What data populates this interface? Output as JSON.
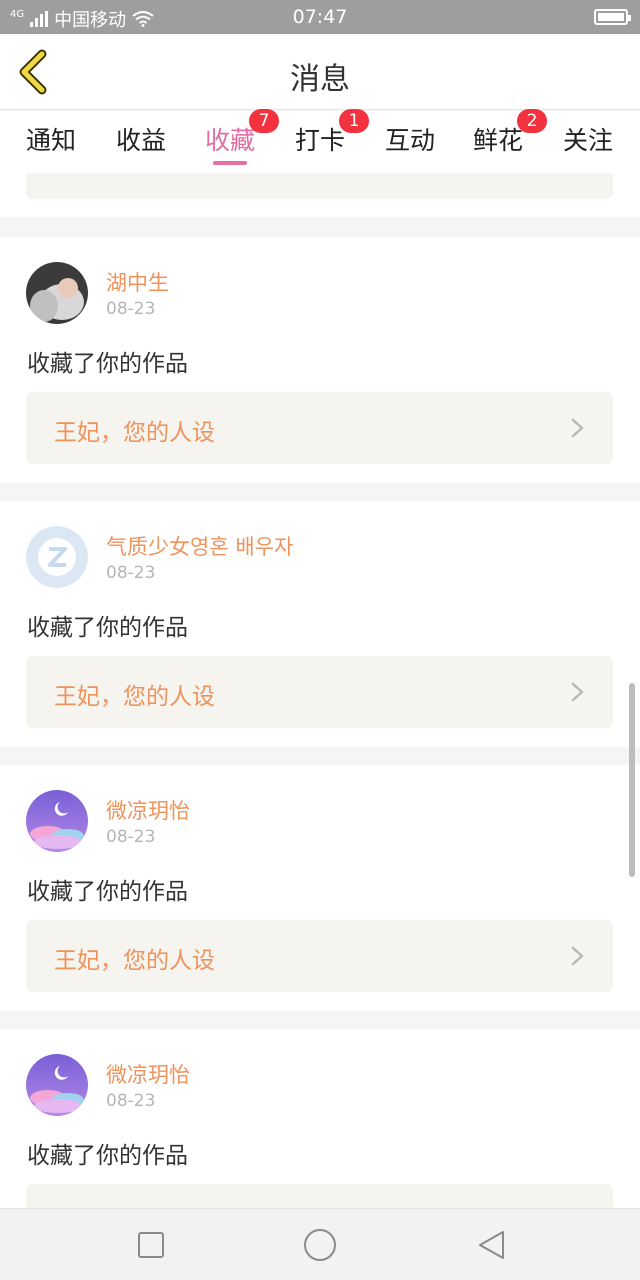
{
  "status_bar": {
    "network_small": "4G",
    "carrier": "中国移动",
    "time": "07:47"
  },
  "header": {
    "title": "消息"
  },
  "tabs": [
    {
      "label": "通知",
      "badge": ""
    },
    {
      "label": "收益",
      "badge": ""
    },
    {
      "label": "收藏",
      "badge": "7",
      "active": true
    },
    {
      "label": "打卡",
      "badge": "1"
    },
    {
      "label": "互动",
      "badge": ""
    },
    {
      "label": "鲜花",
      "badge": "2"
    },
    {
      "label": "关注",
      "badge": ""
    }
  ],
  "colors": {
    "accent": "#e36ea3",
    "username": "#f0935b",
    "badge": "#f2323f"
  },
  "notifications": [
    {
      "user": "湖中生",
      "date": "08-23",
      "action": "收藏了你的作品",
      "work_title": "王妃，您的人设",
      "avatar": "photo-avatar"
    },
    {
      "user": "气质少女영혼 배우자",
      "date": "08-23",
      "action": "收藏了你的作品",
      "work_title": "王妃，您的人设",
      "avatar": "default-avatar"
    },
    {
      "user": "微凉玥怡",
      "date": "08-23",
      "action": "收藏了你的作品",
      "work_title": "王妃，您的人设",
      "avatar": "moon-avatar"
    },
    {
      "user": "微凉玥怡",
      "date": "08-23",
      "action": "收藏了你的作品",
      "work_title": "",
      "avatar": "moon-avatar"
    }
  ],
  "nav_bar": {
    "icons": [
      "square-icon",
      "circle-icon",
      "triangle-back-icon"
    ]
  }
}
